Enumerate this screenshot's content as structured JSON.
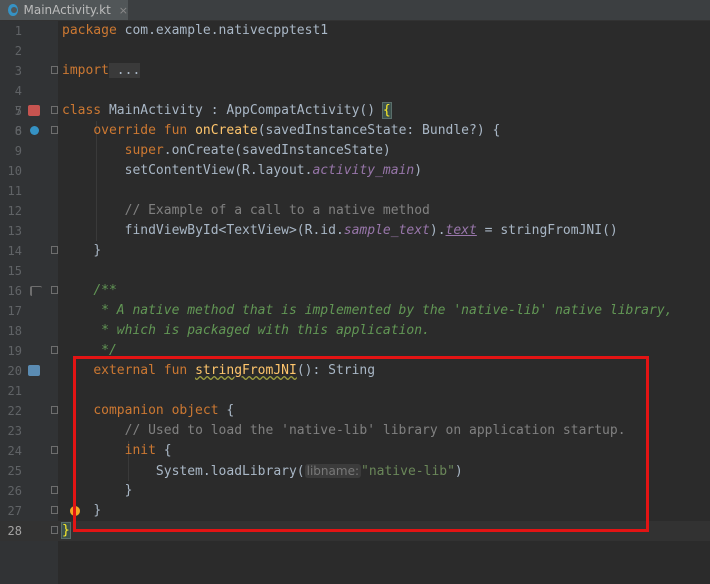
{
  "tab": {
    "filename": "MainActivity.kt",
    "close": "×"
  },
  "lines": [
    {
      "n": "1"
    },
    {
      "n": "2"
    },
    {
      "n": "3"
    },
    {
      "n": "4"
    },
    {
      "n": "5"
    },
    {
      "n": "6"
    },
    {
      "n": "7"
    },
    {
      "n": "8"
    },
    {
      "n": "9"
    },
    {
      "n": "10"
    },
    {
      "n": "11"
    },
    {
      "n": "12"
    },
    {
      "n": "13"
    },
    {
      "n": "14"
    },
    {
      "n": "15"
    },
    {
      "n": "16"
    },
    {
      "n": "17"
    },
    {
      "n": "18"
    },
    {
      "n": "19"
    },
    {
      "n": "20"
    },
    {
      "n": "21"
    },
    {
      "n": "22"
    },
    {
      "n": "23"
    },
    {
      "n": "24"
    },
    {
      "n": "25"
    },
    {
      "n": "26"
    },
    {
      "n": "27"
    },
    {
      "n": "28"
    }
  ],
  "code": {
    "l1_kw": "package",
    "l1_rest": " com.example.nativecpptest1",
    "l3_kw": "import",
    "l3_rest": " ...",
    "l7_kw": "class",
    "l7_rest": " MainActivity : AppCompatActivity() ",
    "l7_brace": "{",
    "l8_kw": "override fun",
    "l8_fn": "onCreate",
    "l8_rest": "(savedInstanceState: Bundle?) {",
    "l9_kw": "super",
    "l9_rest": ".onCreate(savedInstanceState)",
    "l10_a": "setContentView(R.layout.",
    "l10_p": "activity_main",
    "l10_b": ")",
    "l12_cm": "// Example of a call to a native method",
    "l13_a": "findViewById<TextView>(R.id.",
    "l13_p": "sample_text",
    "l13_b": ").",
    "l13_p2": "text",
    "l13_c": " = stringFromJNI()",
    "l14": "}",
    "l16": "/**",
    "l17": " * A native method that is implemented by the 'native-lib' native library,",
    "l18": " * which is packaged with this application.",
    "l19": " */",
    "l20_kw": "external fun",
    "l20_fn": "stringFromJNI",
    "l20_rest": "(): String",
    "l22_kw": "companion object",
    "l22_rest": " {",
    "l23_cm": "// Used to load the 'native-lib' library on application startup.",
    "l24_kw": "init",
    "l24_rest": " {",
    "l25_a": "System.loadLibrary(",
    "l25_hint": "libname:",
    "l25_str": "\"native-lib\"",
    "l25_b": ")",
    "l26": "}",
    "l27": "}",
    "l28": "}"
  }
}
